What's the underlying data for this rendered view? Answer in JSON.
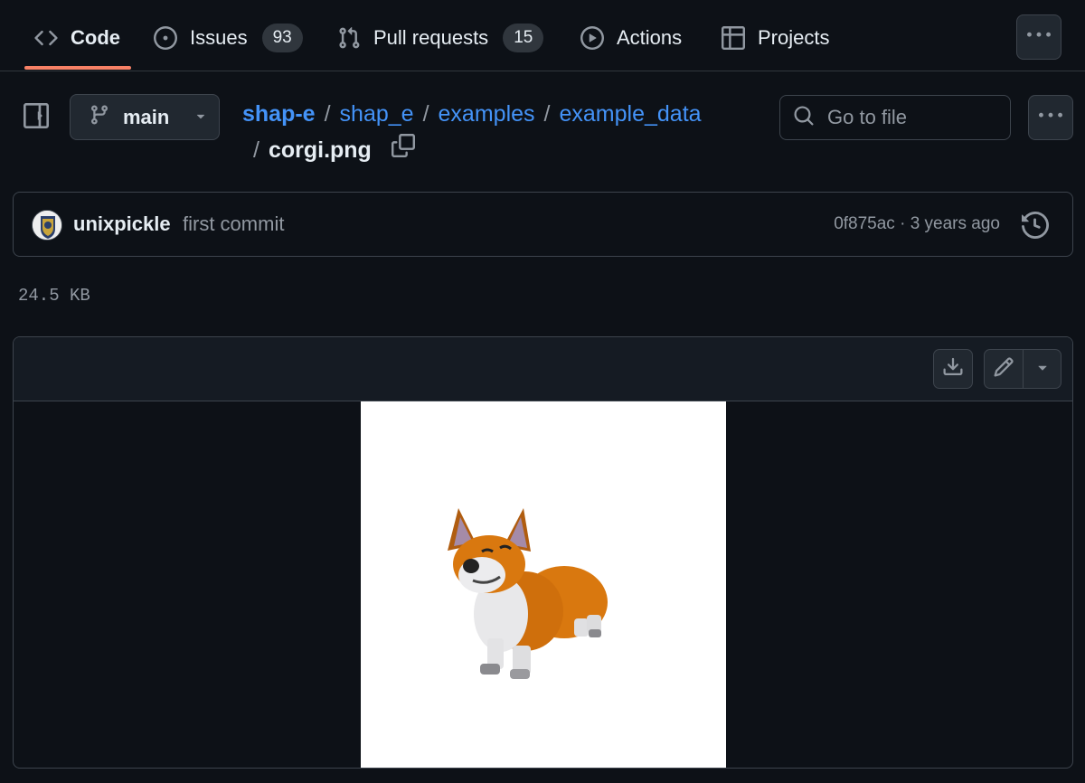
{
  "nav": {
    "tabs": [
      {
        "label": "Code",
        "icon": "code-icon",
        "active": true
      },
      {
        "label": "Issues",
        "icon": "issue-opened-icon",
        "count": "93"
      },
      {
        "label": "Pull requests",
        "icon": "git-pull-request-icon",
        "count": "15"
      },
      {
        "label": "Actions",
        "icon": "play-icon"
      },
      {
        "label": "Projects",
        "icon": "table-icon"
      }
    ],
    "more_icon": "kebab-horizontal-icon"
  },
  "branch": {
    "name": "main",
    "icon": "git-branch-icon"
  },
  "breadcrumb": {
    "repo": "shap-e",
    "dirs": [
      "shap_e",
      "examples",
      "example_data"
    ],
    "separator": "/",
    "file": "corgi.png"
  },
  "goto_file": {
    "placeholder": "Go to file"
  },
  "commit": {
    "author": "unixpickle",
    "message": "first commit",
    "sha": "0f875ac",
    "meta_separator": "·",
    "time": "3 years ago",
    "history_icon": "history-icon"
  },
  "file": {
    "size": "24.5 KB"
  },
  "viewer": {
    "download_icon": "download-icon",
    "edit_icon": "pencil-icon",
    "caret_icon": "triangle-down-icon"
  },
  "colors": {
    "background": "#0d1117",
    "border": "#3d444d",
    "link": "#4493f8",
    "muted": "#9198a1",
    "tab_underline": "#f78166",
    "corgi_orange": "#d9780f"
  }
}
